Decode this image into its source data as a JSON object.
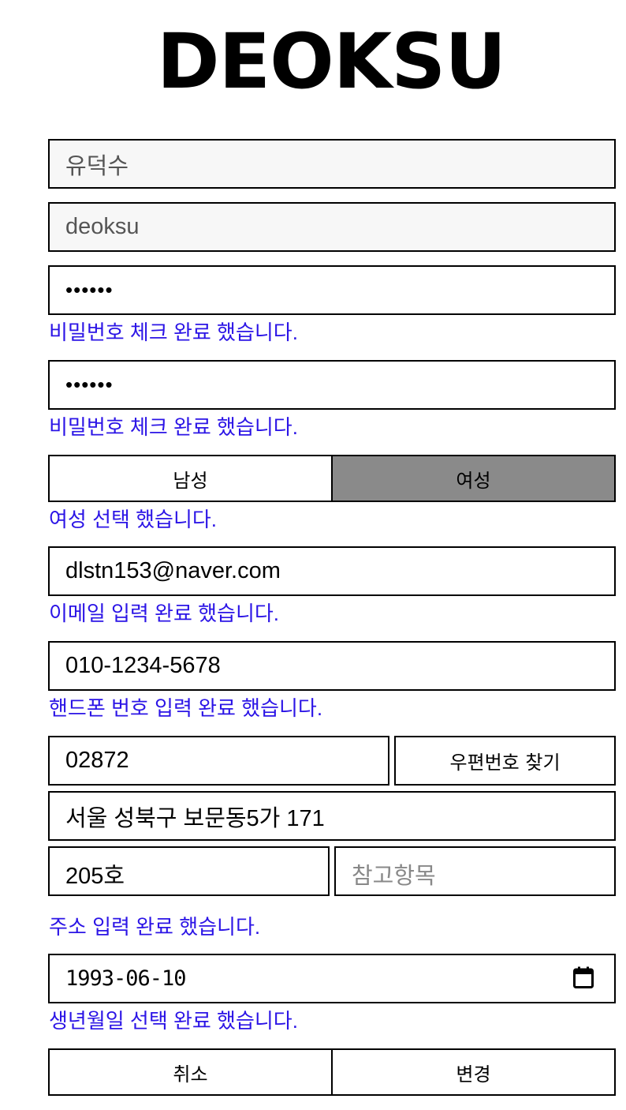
{
  "brand": "DEOKSU",
  "form": {
    "name_value": "유덕수",
    "id_value": "deoksu",
    "password_mask": "••••••",
    "password_msg": "비밀번호 체크 완료 했습니다.",
    "password_confirm_mask": "••••••",
    "password_confirm_msg": "비밀번호 체크 완료 했습니다.",
    "gender": {
      "male_label": "남성",
      "female_label": "여성",
      "selected": "여성",
      "msg": "여성 선택 했습니다."
    },
    "email_value": "dlstn153@naver.com",
    "email_msg": "이메일 입력 완료 했습니다.",
    "phone_value": "010-1234-5678",
    "phone_msg": "핸드폰 번호 입력 완료 했습니다.",
    "postcode_value": "02872",
    "postcode_button": "우편번호 찾기",
    "address_value": "서울 성북구 보문동5가 171",
    "detail_address_value": "205호",
    "extra_address_placeholder": "참고항목",
    "address_msg": "주소 입력 완료 했습니다.",
    "birth_value": "1993-06-10",
    "birth_msg": "생년월일 선택 완료 했습니다.",
    "cancel_label": "취소",
    "submit_label": "변경"
  },
  "colors": {
    "message": "#2b14e6",
    "selected_gender_bg": "#8a8a8a",
    "readonly_bg": "#f7f7f7"
  },
  "icons": {
    "date_picker": "calendar-icon"
  }
}
